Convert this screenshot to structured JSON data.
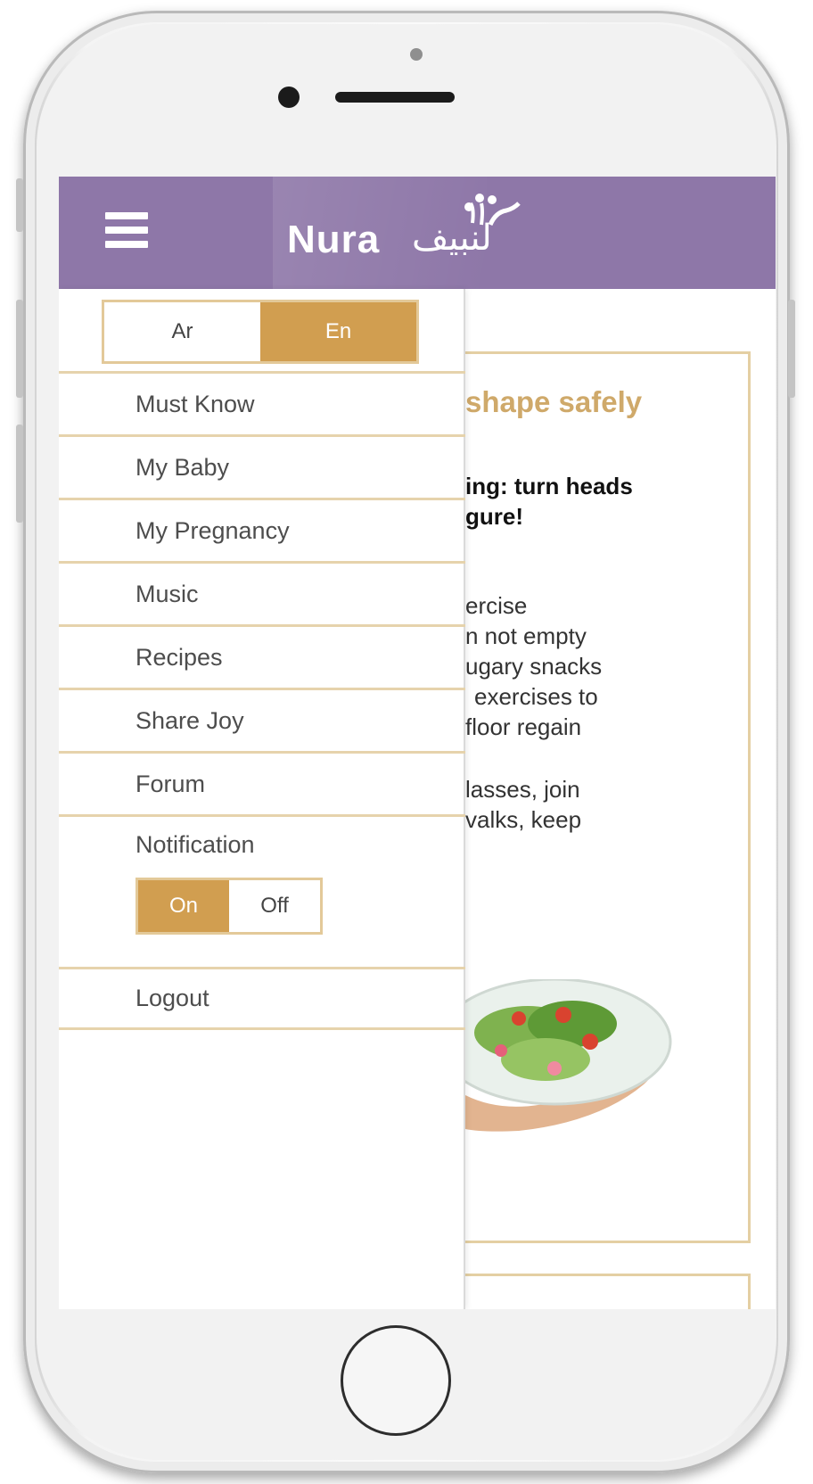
{
  "header": {
    "logo_text": "Nura",
    "logo_arabic": "لنبيف"
  },
  "drawer": {
    "language": {
      "ar_label": "Ar",
      "en_label": "En",
      "selected": "En"
    },
    "items": [
      {
        "label": "Must Know"
      },
      {
        "label": "My Baby"
      },
      {
        "label": "My Pregnancy"
      },
      {
        "label": "Music"
      },
      {
        "label": "Recipes"
      },
      {
        "label": "Share Joy"
      },
      {
        "label": "Forum"
      }
    ],
    "notification": {
      "label": "Notification",
      "on_label": "On",
      "off_label": "Off",
      "selected": "On"
    },
    "logout_label": "Logout"
  },
  "article": {
    "title_fragment": "shape safely",
    "subtitle_line1": "ing: turn heads",
    "subtitle_line2": "gure!",
    "body_lines": [
      "ercise",
      "n not empty",
      "ugary snacks",
      "exercises to",
      "floor regain",
      "lasses, join",
      "valks, keep"
    ]
  },
  "colors": {
    "header_purple": "#8e77a8",
    "accent_gold": "#d19e50",
    "divider_beige": "#e6d3ac"
  }
}
